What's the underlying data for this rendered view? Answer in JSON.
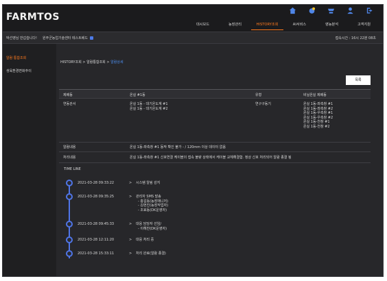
{
  "header": {
    "logo": "FARMTOS",
    "icons": [
      "home-icon",
      "notification-icon",
      "shop-icon",
      "user-icon",
      "logout-icon"
    ],
    "nav": [
      "대시보드",
      "농장관리",
      "HISTORY조회",
      "AI서비스",
      "영농분석",
      "고객지원"
    ],
    "active_nav": "HISTORY조회"
  },
  "infobar": {
    "greeting": "박선영님 반갑습니다!",
    "site": "원주군농업기술센터 테스트베드",
    "access_time": "접속시간 : 16시 22분 08초"
  },
  "sidebar": {
    "items": [
      "알람 통합조회",
      "생육환경변화추이"
    ]
  },
  "breadcrumb": {
    "path": "HISTORY조회 > 알람통합조회 > ",
    "current": "알람상세"
  },
  "buttons": {
    "list": "목록"
  },
  "table": {
    "headers": [
      "제배동",
      "온실 #1동",
      "유형",
      "비닐온실 제배동"
    ],
    "row1": {
      "label": "연동관서",
      "col2": [
        "온실 1동 - 대기온도계 #1",
        "온실 1동 - 대기온도계 #2"
      ],
      "col3": "연구구동기",
      "col4": [
        "온실 1동-좌측창 #1",
        "온실 1동-좌측창 #2",
        "온실 1동-우측창 #1",
        "온실 1동-우측창 #2",
        "온실 1동-천창 #1",
        "온실 1동-천창 #2"
      ]
    },
    "row2": {
      "label": "알람내용",
      "text": "온실 1동-좌측창 #1 동작 확인 불가 - / 120mm 이상 데이터 없음"
    },
    "row3": {
      "label": "처리내용",
      "text": "온실 1동-좌측창 #1 신호연결 케이블의 접속 불량 상태에서 케이블 교체해결함. 정상 신호 처리되어 알람 종결 됨"
    }
  },
  "timeline": {
    "title": "TIME LINE",
    "entries": [
      {
        "time": "2021-03-28 09:33:22",
        "arrow": ">",
        "lines": [
          "시스템 알림 감지"
        ]
      },
      {
        "time": "2021-03-28 09:35:25",
        "arrow": ">",
        "lines": [
          "관리자 SMS 발송",
          "- 홍길동(농장매니저)",
          "- 김현진(농장작업자)",
          "- 조효동(DK운영자)"
        ]
      },
      {
        "time": "2021-03-28 09:45:33",
        "arrow": ">",
        "lines": [
          "대응 담당자 선임/",
          "- 이해찬(DK운영자)"
        ]
      },
      {
        "time": "2021-03-28 12:11:20",
        "arrow": ">",
        "lines": [
          "대응 처리 중"
        ]
      },
      {
        "time": "2021-03-28 15:33:11",
        "arrow": ">",
        "lines": [
          "처리 완료(알람 종결)"
        ]
      }
    ]
  }
}
